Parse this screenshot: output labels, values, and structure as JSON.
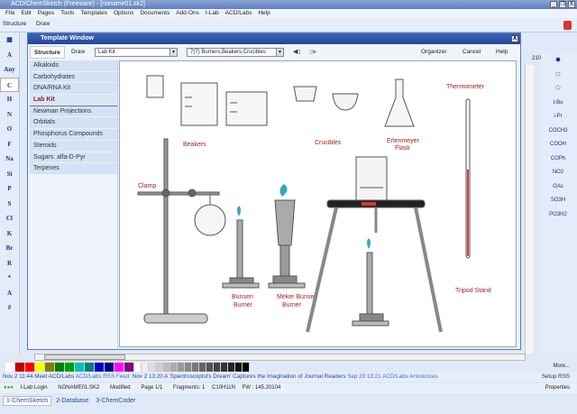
{
  "app": {
    "title": "ACD/ChemSketch (Freeware) - [noname01.sk2]",
    "window_controls": [
      "_",
      "❐",
      "X"
    ]
  },
  "menu": [
    "File",
    "Edit",
    "Pages",
    "Tools",
    "Templates",
    "Options",
    "Documents",
    "Add-Ons",
    "I-Lab",
    "ACD/Labs",
    "Help"
  ],
  "toolbar": {
    "structure_tab": "Structure",
    "draw_tab": "Draw"
  },
  "left_tools": [
    "A",
    "Any",
    "C",
    "H",
    "N",
    "O",
    "F",
    "Na",
    "Si",
    "P",
    "S",
    "Cl",
    "K",
    "Br",
    "R",
    "*",
    "A",
    "#"
  ],
  "right_tools": [
    "t-Bu",
    "i-Pr",
    "COCH3",
    "COOH",
    "COPh",
    "NO2",
    "OAc",
    "SO3H",
    "PO3H2"
  ],
  "ruler_value": "210",
  "template_window": {
    "title": "Template Window",
    "close": "X",
    "tabs": [
      "Structure",
      "Draw"
    ],
    "kit_select": "Lab Kit",
    "page_select": "7(7) Burners,Beakers,Crucibles",
    "buttons": [
      "Organizer",
      "Cancel",
      "Help"
    ],
    "categories": [
      "Alkaloids",
      "Carbohydrates",
      "DNA/RNA Kit",
      "Lab Kit",
      "Newman Projections",
      "Orbitals",
      "Phosphorus Compounds",
      "Steroids",
      "Sugars: alfa-D-Pyr",
      "Terpenes"
    ],
    "active_category": "Lab Kit",
    "labels": {
      "beakers": "Beakers",
      "crucibles": "Crucibles",
      "erlenmeyer": [
        "Erlenmeyer",
        "Flask"
      ],
      "thermometer": "Thermometer",
      "clamp": "Clamp",
      "bunsen": [
        "Bunsen",
        "Burner"
      ],
      "meker": [
        "Meker Bunsen",
        "Burner"
      ],
      "tripod": "Tripod Stand"
    }
  },
  "palette": {
    "colors": [
      "#ffffff",
      "#c00000",
      "#ff0000",
      "#ffff00",
      "#808000",
      "#008000",
      "#00a000",
      "#00c0c0",
      "#008080",
      "#0000c0",
      "#000080",
      "#ff00ff",
      "#800080",
      "#ffffff",
      "#eeeeee",
      "#dddddd",
      "#cccccc",
      "#bbbbbb",
      "#aaaaaa",
      "#999999",
      "#888888",
      "#777777",
      "#666666",
      "#555555",
      "#444444",
      "#333333",
      "#222222",
      "#111111",
      "#000000"
    ],
    "more": "More..."
  },
  "rss": {
    "item1": "Nov 2 11:44 Meet ACD/Labs",
    "feed_label": "ACD/Labs RSS Feed:",
    "item2": "Nov 2 13:20 A 'Spectroscopist's Dream' Captures the Imagination of Journal Readers",
    "item3": "Sep 29 13:21 ACD/Labs Announces",
    "setup": "Setup RSS"
  },
  "status": {
    "ilab": "I-Lab Login",
    "file": "NONAME01.SK2",
    "modified": "Modified",
    "page": "Page 1/1",
    "fragments": "Fragments: 1",
    "formula": "C10H11N",
    "fw": "FW : 145.20104",
    "properties": "Properties"
  },
  "tabs": [
    "1-ChemSketch",
    "2-Database",
    "3-ChemCoder"
  ]
}
